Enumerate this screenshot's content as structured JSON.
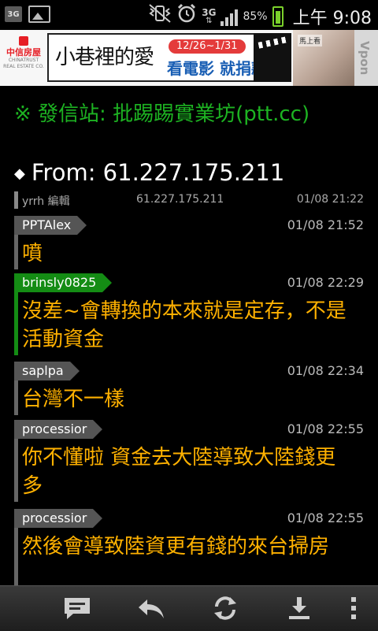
{
  "status_bar": {
    "network": "3G",
    "battery_percent": "85%",
    "time": "上午 9:08",
    "icons": [
      "3g-badge-icon",
      "picture-icon",
      "vibrate-mute-icon",
      "alarm-icon",
      "3g-network-icon",
      "signal-icon",
      "battery-icon"
    ]
  },
  "ad": {
    "brand_zh": "中信房屋",
    "brand_en": "CHINATRUST REAL ESTATE CO.",
    "title": "小巷裡的愛",
    "dates": "12/26~1/31",
    "slogan": "看電影 就捐款",
    "photo_caption": "馬上看",
    "network": "Vpon"
  },
  "post": {
    "source_line": "※ 發信站: 批踢踢實業坊(ptt.cc)",
    "from_label": "From: 61.227.175.211"
  },
  "edit": {
    "user": "yrrh 編輯",
    "ip": "61.227.175.211",
    "time": "01/08 21:22"
  },
  "pushes": [
    {
      "user": "PPTAlex",
      "time": "01/08 21:52",
      "message": "噴",
      "color": "#555555"
    },
    {
      "user": "brinsly0825",
      "time": "01/08 22:29",
      "message": "沒差~會轉換的本來就是定存，不是活動資金",
      "color": "#148c14"
    },
    {
      "user": "saplpa",
      "time": "01/08 22:34",
      "message": "台灣不一樣",
      "color": "#555555"
    },
    {
      "user": "processior",
      "time": "01/08 22:55",
      "message": "你不懂啦 資金去大陸導致大陸錢更多",
      "color": "#555555"
    },
    {
      "user": "processior",
      "time": "01/08 22:55",
      "message": "然後會導致陸資更有錢的來台掃房",
      "color": "#555555"
    }
  ],
  "toolbar": {
    "buttons": [
      "comment-icon",
      "reply-icon",
      "refresh-icon",
      "download-icon",
      "more-icon"
    ]
  },
  "colors": {
    "push_message": "#ffb100",
    "source_line": "#1db322",
    "accent_green": "#148c14"
  }
}
